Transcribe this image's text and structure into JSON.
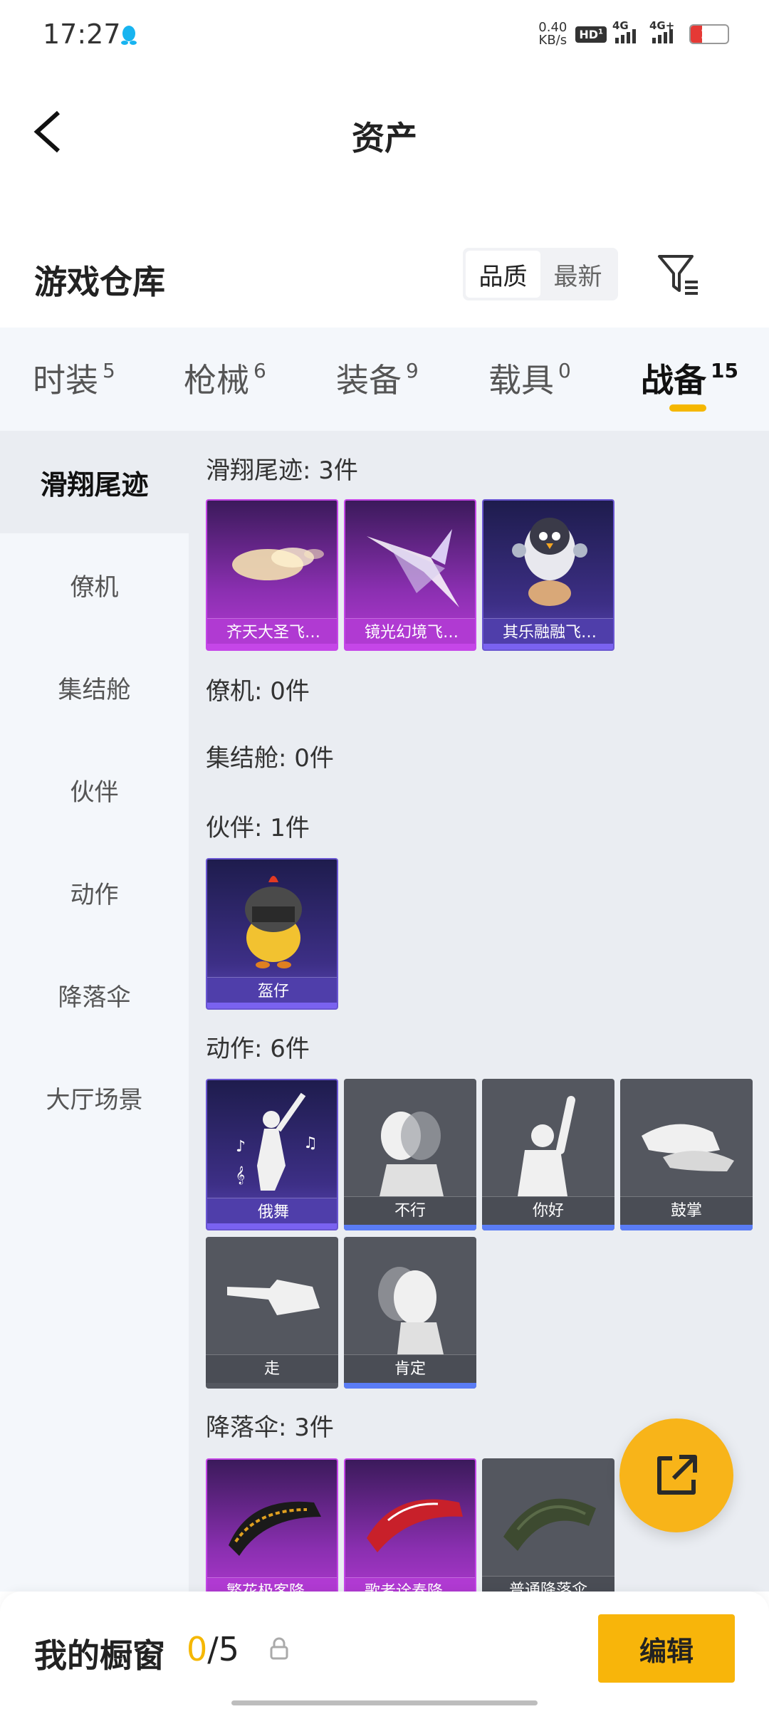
{
  "status": {
    "time": "17:27",
    "speed_value": "0.40",
    "speed_unit": "KB/s",
    "hd": "HD",
    "sim1": "1",
    "sim2": "2",
    "net1": "4G",
    "net2": "4G+",
    "battery": "17"
  },
  "header": {
    "title": "资产"
  },
  "warehouse": {
    "title": "游戏仓库",
    "sort_options": [
      "品质",
      "最新"
    ],
    "active_sort": "品质"
  },
  "tabs": [
    {
      "label": "时装",
      "count": "5"
    },
    {
      "label": "枪械",
      "count": "6"
    },
    {
      "label": "装备",
      "count": "9"
    },
    {
      "label": "载具",
      "count": "0"
    },
    {
      "label": "战备",
      "count": "15",
      "active": true
    }
  ],
  "sidenav": [
    "滑翔尾迹",
    "僚机",
    "集结舱",
    "伙伴",
    "动作",
    "降落伞",
    "大厅场景"
  ],
  "sections": {
    "glide": {
      "title": "滑翔尾迹: 3件",
      "items": [
        "齐天大圣飞…",
        "镜光幻境飞…",
        "其乐融融飞…"
      ]
    },
    "wingman": {
      "title": "僚机: 0件"
    },
    "capsule": {
      "title": "集结舱: 0件"
    },
    "partner": {
      "title": "伙伴: 1件",
      "items": [
        "盔仔"
      ]
    },
    "emote": {
      "title": "动作: 6件",
      "items": [
        "俄舞",
        "不行",
        "你好",
        "鼓掌",
        "走",
        "肯定"
      ]
    },
    "parachute": {
      "title": "降落伞: 3件",
      "items": [
        "繁花极客降…",
        "歌者诠奏降…",
        "普通降落伞"
      ]
    }
  },
  "showcase": {
    "label": "我的橱窗",
    "current": "0",
    "total": "/5",
    "edit": "编辑"
  },
  "icons": {
    "qq": "qq-penguin-icon",
    "back": "back-arrow-icon",
    "filter": "filter-icon",
    "share": "share-external-icon",
    "lock": "lock-icon"
  },
  "colors": {
    "accent": "#f8b50a",
    "purple_rarity": "#c546e8",
    "navy_rarity": "#6a56d2",
    "tab_indicator": "#f5b700"
  }
}
